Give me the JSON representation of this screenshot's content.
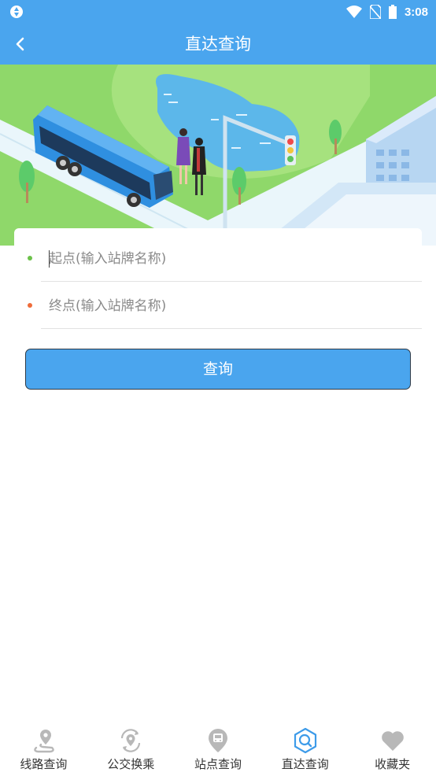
{
  "status_bar": {
    "time": "3:08"
  },
  "header": {
    "title": "直达查询"
  },
  "form": {
    "start_placeholder": "起点(输入站牌名称)",
    "end_placeholder": "终点(输入站牌名称)",
    "start_dot_color": "#6cc24a",
    "end_dot_color": "#ef6c3a",
    "query_label": "查询"
  },
  "tabbar": {
    "active_color": "#3d9be9",
    "inactive_color": "#b8b8b8",
    "items": [
      {
        "label": "线路查询",
        "icon": "route-pin-icon"
      },
      {
        "label": "公交换乘",
        "icon": "transfer-location-icon"
      },
      {
        "label": "站点查询",
        "icon": "station-pin-icon"
      },
      {
        "label": "直达查询",
        "icon": "direct-search-icon",
        "active": true
      },
      {
        "label": "收藏夹",
        "icon": "heart-icon"
      }
    ]
  }
}
